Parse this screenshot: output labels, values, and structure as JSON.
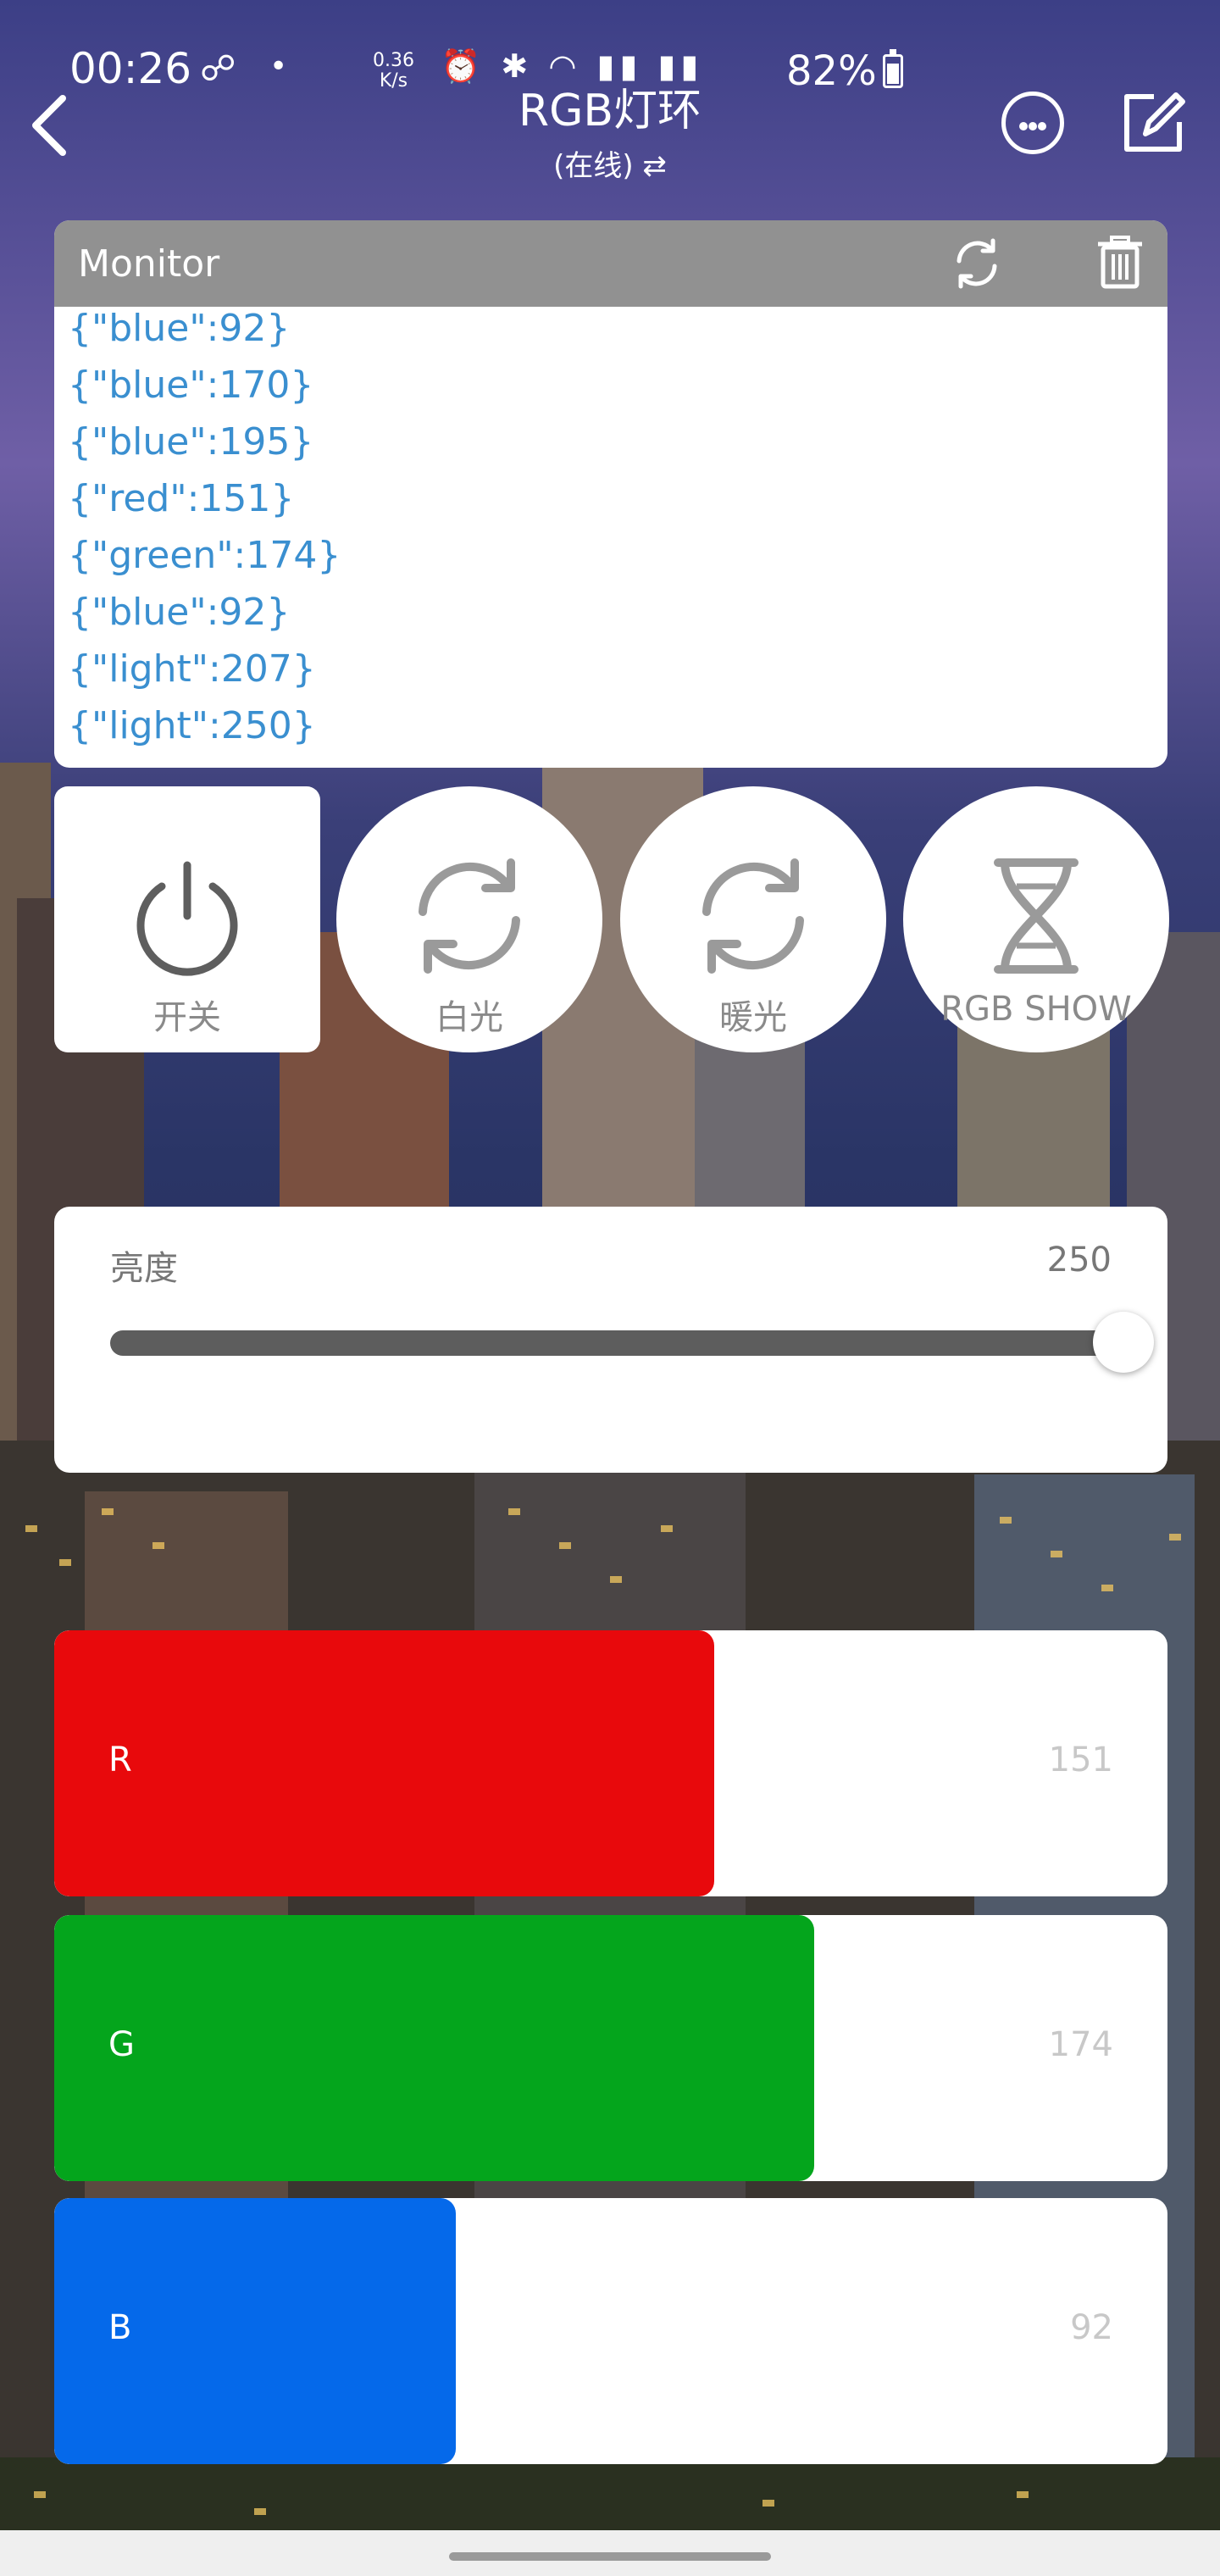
{
  "status_bar": {
    "time": "00:26",
    "speed_value": "0.36",
    "speed_unit": "K/s",
    "battery": "82%"
  },
  "header": {
    "title": "RGB灯环",
    "subtitle": "(在线) ⇄"
  },
  "monitor": {
    "title": "Monitor",
    "lines": [
      "{\"blue\":92}",
      "{\"blue\":170}",
      "{\"blue\":195}",
      "{\"red\":151}",
      "{\"green\":174}",
      "{\"blue\":92}",
      "{\"light\":207}",
      "{\"light\":250}"
    ]
  },
  "buttons": {
    "power": "开关",
    "white": "白光",
    "warm": "暖光",
    "rgb_show": "RGB SHOW"
  },
  "brightness": {
    "label": "亮度",
    "value": "250",
    "max": 255
  },
  "rgb": {
    "r": {
      "label": "R",
      "value": "151",
      "color": "#e8090c",
      "fraction": 0.593
    },
    "g": {
      "label": "G",
      "value": "174",
      "color": "#04a51c",
      "fraction": 0.683
    },
    "b": {
      "label": "B",
      "value": "92",
      "color": "#0569ea",
      "fraction": 0.361
    }
  }
}
